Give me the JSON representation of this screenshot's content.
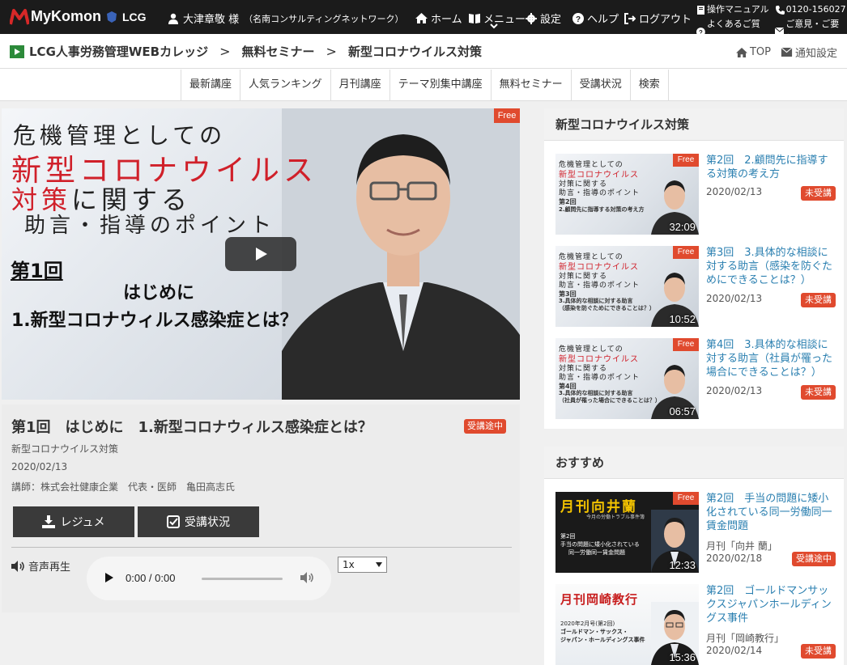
{
  "header": {
    "brand": "MyKomon",
    "brand_sub": "LCG",
    "user_name": "大津章敬 様",
    "user_org": "（名南コンサルティングネットワーク）",
    "nav": [
      {
        "label": "ホーム",
        "icon": "home-icon"
      },
      {
        "label": "メニュー",
        "icon": "book-icon"
      },
      {
        "label": "設定",
        "icon": "gear-icon"
      },
      {
        "label": "ヘルプ",
        "icon": "help-icon"
      },
      {
        "label": "ログアウト",
        "icon": "logout-icon"
      }
    ],
    "manual": "操作マニュアル",
    "phone": "0120-156027",
    "faq": "よくあるご質問",
    "feedback": "ご意見・ご要望"
  },
  "breadcrumb": {
    "items": [
      "LCG人事労務管理WEBカレッジ",
      "無料セミナー",
      "新型コロナウイルス対策"
    ],
    "separator": ">",
    "top_link": "TOP",
    "notify_link": "通知設定"
  },
  "category_nav": [
    "最新講座",
    "人気ランキング",
    "月刊講座",
    "テーマ別集中講座",
    "無料セミナー",
    "受講状況",
    "検索"
  ],
  "video": {
    "free_badge": "Free",
    "slide": {
      "line1": "危機管理としての",
      "line2": "新型コロナウイルス",
      "line3_red": "対策",
      "line3_rest": "に関する",
      "line4": "助言・指導のポイント",
      "episode": "第1回",
      "heading": "はじめに",
      "subheading": "1.新型コロナウィルス感染症とは？"
    },
    "title": "第1回　はじめに　1.新型コロナウィルス感染症とは？",
    "status": "受講途中",
    "category": "新型コロナウイルス対策",
    "date": "2020/02/13",
    "lecturer": "講師：株式会社健康企業　代表・医師　亀田高志氏",
    "resume_button": "レジュメ",
    "status_button": "受講状況",
    "audio_label": "音声再生",
    "audio_time": "0:00 / 0:00",
    "speed": "1x"
  },
  "related": {
    "heading": "新型コロナウイルス対策",
    "items": [
      {
        "title": "第2回　2.顧問先に指導する対策の考え方",
        "date": "2020/02/13",
        "badge": "未受講",
        "duration": "32:09",
        "free": "Free",
        "thumb_lines": [
          "危機管理としての",
          "新型コロナウイルス",
          "対策に関する",
          "助言・指導のポイント",
          "第2回",
          "2.顧問先に指導する対策の考え方"
        ]
      },
      {
        "title": "第3回　3.具体的な相談に対する助言（感染を防ぐためにできることは？）",
        "date": "2020/02/13",
        "badge": "未受講",
        "duration": "10:52",
        "free": "Free",
        "thumb_lines": [
          "危機管理としての",
          "新型コロナウイルス",
          "対策に関する",
          "助言・指導のポイント",
          "第3回",
          "3.具体的な相談に対する助言",
          "（感染を防ぐためにできることは？）"
        ]
      },
      {
        "title": "第4回　3.具体的な相談に対する助言（社員が罹った場合にできることは？）",
        "date": "2020/02/13",
        "badge": "未受講",
        "duration": "06:57",
        "free": "Free",
        "thumb_lines": [
          "危機管理としての",
          "新型コロナウイルス",
          "対策に関する",
          "助言・指導のポイント",
          "第4回",
          "3.具体的な相談に対する助言",
          "（社員が罹った場合にできることは？）"
        ]
      }
    ]
  },
  "recommended": {
    "heading": "おすすめ",
    "items": [
      {
        "title": "第2回　手当の問題に矮小化されている同一労働同一賃金問題",
        "source": "月刊「向井 蘭」",
        "date": "2020/02/18",
        "badge": "受講途中",
        "duration": "12:33",
        "free": "Free",
        "thumb_lines": [
          "月刊向井蘭",
          "今月の労働トラブル事件簿",
          "第2回",
          "手当の問題に矮小化されている",
          "同一労働同一賃金問題"
        ]
      },
      {
        "title": "第2回　ゴールドマンサックスジャパンホールディングス事件",
        "source": "月刊「岡崎教行」",
        "date": "2020/02/14",
        "badge": "未受講",
        "duration": "15:36",
        "thumb_lines": [
          "月刊岡崎教行",
          "2020年2月号(第2回)",
          "ゴールドマン・サックス・",
          "ジャパン・ホールディングス事件"
        ]
      }
    ]
  },
  "colors": {
    "accent": "#e04a2e",
    "topbar": "#1b1b1b",
    "link": "#2a7fb0",
    "button": "#3a3a3a"
  }
}
